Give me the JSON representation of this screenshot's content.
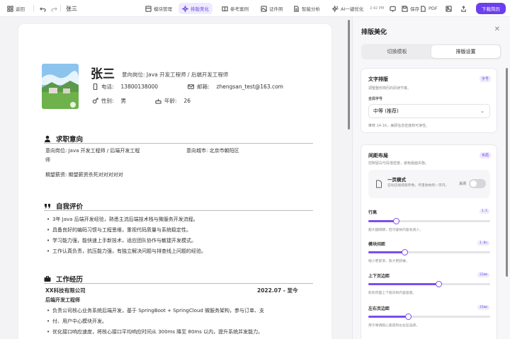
{
  "toolbar": {
    "back_label": "返回",
    "doc_title": "张三",
    "items": [
      {
        "label": "模块管理"
      },
      {
        "label": "排版美化"
      },
      {
        "label": "参考案例"
      },
      {
        "label": "证件照"
      },
      {
        "label": "智能分析"
      },
      {
        "label": "AI一键优化"
      }
    ],
    "time": "2:42 PM",
    "save_label": "保存",
    "pdf_label": "PDF",
    "download_label": "下载简历",
    "accent": "#6c3ef0"
  },
  "resume": {
    "name": "张三",
    "position_line": "意向岗位: Java 开发工程师 / 后端开发工程师",
    "phone_label": "电话:",
    "phone": "13800138000",
    "email_label": "邮箱:",
    "email": "zhengsan_test@163.com",
    "gender_label": "性别:",
    "gender": "男",
    "age_label": "年龄:",
    "age": "26",
    "intent": {
      "title": "求职意向",
      "role_label": "意向岗位:",
      "role": "Java 开发工程师 / 后端开发工程",
      "role_wrap": "师",
      "city_label": "意向城市:",
      "city": "北京市朝阳区",
      "salary_label": "期望薪资:",
      "salary": "期望薪资杀死对对对对对"
    },
    "self_eval": {
      "title": "自我评价",
      "items": [
        "3年 Java 后端开发经验，熟悉主流后端技术栈与微服务开发流程。",
        "具备良好的编码习惯与工程思维，重视代码质量与系统稳定性。",
        "学习能力强，能快速上手新技术，适应团队协作与敏捷开发模式。",
        "工作认真负责，抗压能力强，有独立解决问题与排查线上问题的经验。"
      ]
    },
    "work": {
      "title": "工作经历",
      "company": "XX科技有限公司",
      "period": "2022.07 - 至今",
      "role": "后端开发工程师",
      "items": [
        "负责公司核心业务系统后端开发，基于 SpringBoot + SpringCloud 微服务架构，参与订单、支",
        "付、用户中心模块开发。",
        "优化接口响应速度，将核心接口平均响应时间从 300ms 降至 80ms 以内，提升系统并发能力。"
      ]
    }
  },
  "panel": {
    "title": "排版美化",
    "tabs": [
      "切换模板",
      "排版设置"
    ],
    "active_tab": "排版设置",
    "typography": {
      "title": "文字排版",
      "tag": "字号",
      "desc": "调整整份简历的阅读节奏。",
      "field_label": "全局字号",
      "select_value": "中等 (推荐)",
      "hint": "推荐 14-16，兼顾信息密度和可读性。"
    },
    "spacing": {
      "title": "间距布局",
      "tag": "布局",
      "desc": "控制留白与段落密度，避免版面失衡。",
      "one_page_title": "一页模式",
      "one_page_desc": "自动压缩排版参数，尽量收纳到一页内。",
      "one_page_state": "关闭",
      "one_page_on": false,
      "sliders": [
        {
          "label": "行高",
          "value": "1.5",
          "fraction": 0.23,
          "hint": "越大越疏朗，但可容纳内容会减少。"
        },
        {
          "label": "模块间距",
          "value": "1.0x",
          "fraction": 0.3,
          "hint": "缩小更紧凑，放大更舒展。"
        },
        {
          "label": "上下页边距",
          "value": "22mm",
          "fraction": 0.58,
          "hint": "影响页面上下留白和内容容量。"
        },
        {
          "label": "左右页边距",
          "value": "15mm",
          "fraction": 0.33,
          "hint": "用于微调版心宽度和左右压迫感。"
        }
      ]
    }
  }
}
